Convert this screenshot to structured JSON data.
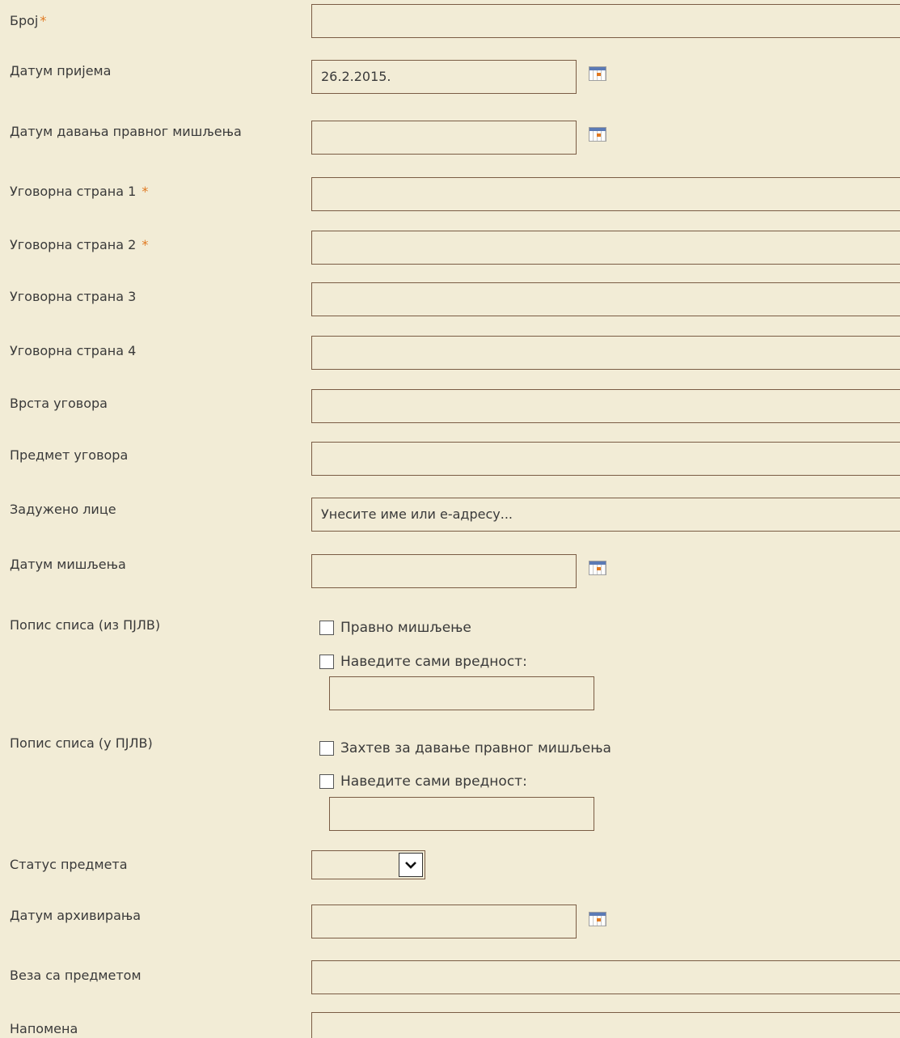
{
  "colors": {
    "background": "#f2ecd6",
    "input_border": "#7a5c44",
    "required_marker": "#e07820",
    "text": "#3a3a3a"
  },
  "form": {
    "required_marker": "*",
    "broj_label": "Број",
    "datum_prijema_label": "Датум пријема",
    "datum_prijema_value": "26.2.2015.",
    "datum_davanja_label": "Датум давања правног мишљења",
    "ugovorna_strana_1_label": "Уговорна страна 1",
    "ugovorna_strana_2_label": "Уговорна страна 2",
    "ugovorna_strana_3_label": "Уговорна страна 3",
    "ugovorna_strana_4_label": "Уговорна страна 4",
    "vrsta_ugovora_label": "Врста уговора",
    "predmet_ugovora_label": "Предмет уговора",
    "zaduzeno_lice_label": "Задужено лице",
    "zaduzeno_lice_placeholder": "Унесите име или е-адресу...",
    "datum_misljenja_label": "Датум мишљења",
    "popis_iz_label": "Попис списа (из ПЈЛВ)",
    "popis_iz_options": [
      "Правно мишљење",
      "Наведите сами вредност:"
    ],
    "popis_u_label": "Попис списа (у ПЈЛВ)",
    "popis_u_options": [
      "Захтев за давање правног мишљења",
      "Наведите сами вредност:"
    ],
    "status_predmeta_label": "Статус предмета",
    "datum_arhiviranja_label": "Датум архивирања",
    "veza_sa_predmetom_label": "Веза са предметом",
    "napomena_label": "Напомена"
  },
  "icons": {
    "calendar": "calendar-icon",
    "dropdown": "chevron-down-icon"
  }
}
